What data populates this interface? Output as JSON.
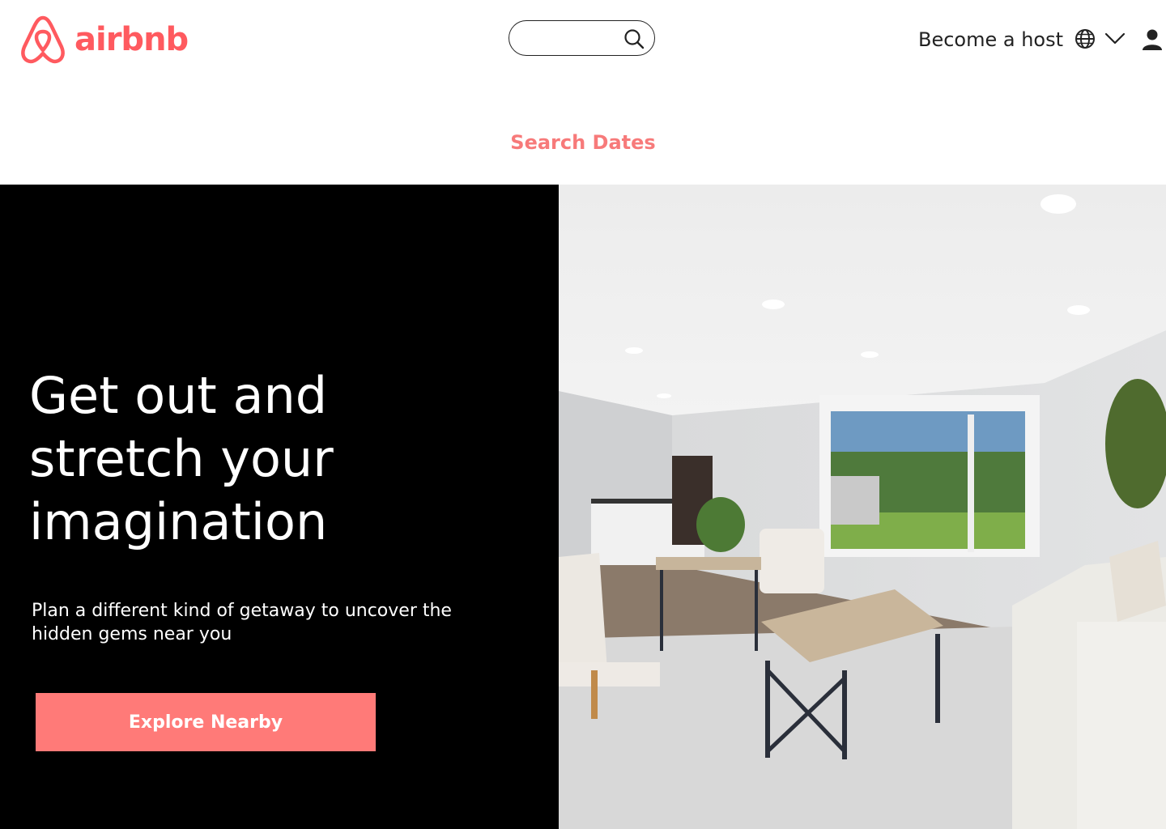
{
  "brand": {
    "name": "airbnb",
    "color": "#ff5a5f",
    "icon": "airbnb-logo-icon"
  },
  "search": {
    "placeholder": "",
    "value": "",
    "icon": "search-icon"
  },
  "nav": {
    "host_label": "Become a host",
    "language_icon": "globe-icon",
    "menu_icon": "chevron-down-icon",
    "profile_icon": "user-icon"
  },
  "search_dates_label": "Search Dates",
  "hero": {
    "title": "Get out and stretch your imagination",
    "subtitle": "Plan a different kind of getaway to uncover the hidden gems near you",
    "cta_label": "Explore Nearby",
    "cta_color": "#ff7a78",
    "image": "living-room-photo"
  },
  "colors": {
    "accent": "#f77a7a",
    "hero_bg": "#000000"
  }
}
